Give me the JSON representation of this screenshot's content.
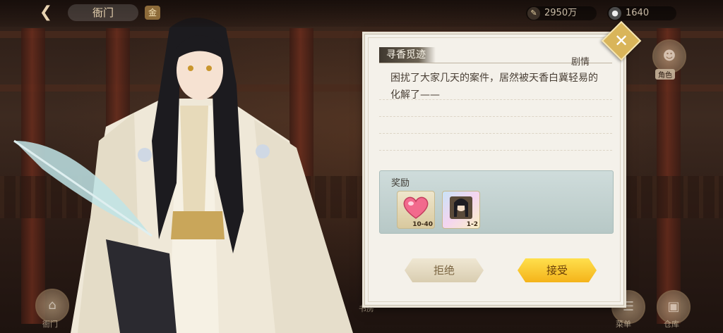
{
  "topbar": {
    "back_icon": "back-arrow-icon",
    "hall_title": "衙门",
    "tag_label": "金",
    "currency_a": {
      "icon": "feather-coin-icon",
      "value": "2950万"
    },
    "currency_b": {
      "icon": "silver-coin-icon",
      "value": "1640"
    }
  },
  "side": {
    "top_right_label": "角色"
  },
  "dialog": {
    "title": "寻香觅迹",
    "category": "剧情",
    "story_text": "困扰了大家几天的案件，居然被天香白冀轻易的化解了——",
    "reward_label": "奖励",
    "rewards": [
      {
        "icon": "heart-icon",
        "qty": "10-40"
      },
      {
        "icon": "character-card-icon",
        "qty": "1-2"
      }
    ],
    "refuse_label": "拒绝",
    "accept_label": "接受",
    "close_icon": "close-icon",
    "colors": {
      "accept": "#f4b31a",
      "refuse": "#d9cdb0",
      "close": "#d9b55a"
    }
  },
  "bottom": {
    "left_label": "衙门",
    "mid_label": "书房",
    "right_label_a": "菜单",
    "right_label_b": "仓库"
  }
}
